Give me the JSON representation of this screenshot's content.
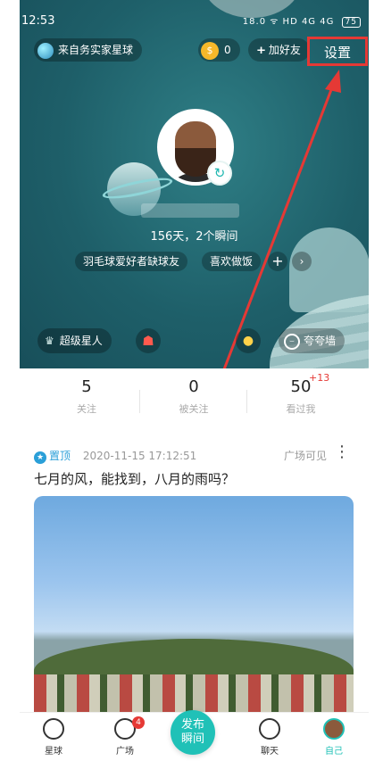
{
  "status_bar": {
    "time": "12:53",
    "right": "18.0 ᯤ HD 4G 4G",
    "battery": "75"
  },
  "header": {
    "planet_chip": "来自务实家星球",
    "coins": "0",
    "add_friend": "加好友",
    "settings": "设置"
  },
  "profile": {
    "days": "156天，2个瞬间",
    "tags": [
      "羽毛球爱好者缺球友",
      "喜欢做饭"
    ],
    "vip_label": "超级星人",
    "praise_wall": "夸夸墙"
  },
  "stats": [
    {
      "value": "5",
      "label": "关注"
    },
    {
      "value": "0",
      "label": "被关注"
    },
    {
      "value": "50",
      "label": "看过我",
      "increment": "+13"
    }
  ],
  "post": {
    "pin_label": "置顶",
    "timestamp": "2020-11-15 17:12:51",
    "visibility": "广场可见",
    "text": "七月的风，能找到，八月的雨吗？"
  },
  "tabbar": {
    "planet": "星球",
    "square": "广场",
    "square_badge": "4",
    "publish_line1": "发布",
    "publish_line2": "瞬间",
    "chat": "聊天",
    "me": "自己"
  },
  "colors": {
    "accent": "#20c1b7",
    "highlight": "#e53935",
    "hero_bg": "#1e5f69"
  }
}
